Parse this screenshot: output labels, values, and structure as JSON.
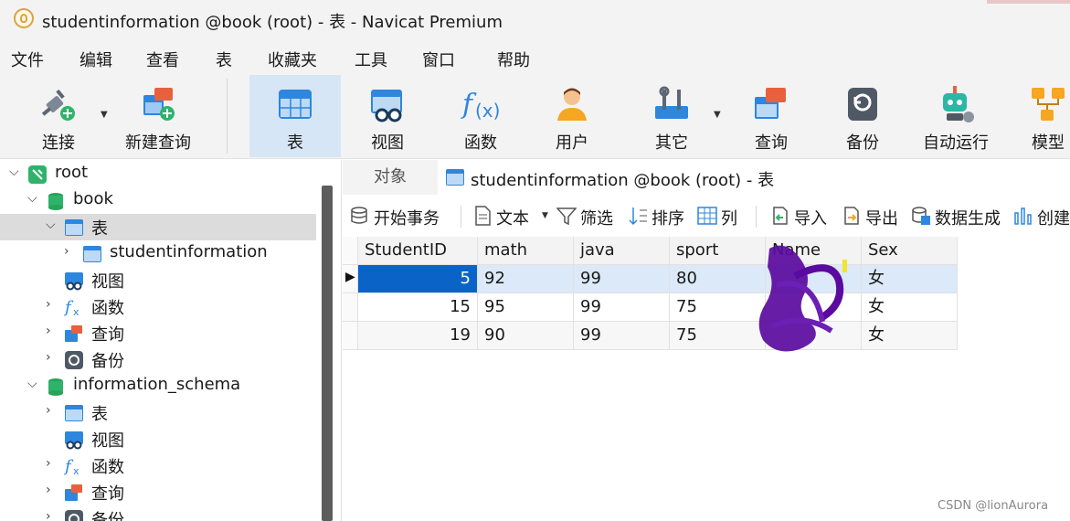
{
  "window": {
    "title": "studentinformation @book (root) - 表 - Navicat Premium"
  },
  "menu": [
    "文件",
    "编辑",
    "查看",
    "表",
    "收藏夹",
    "工具",
    "窗口",
    "帮助"
  ],
  "toolbar": {
    "connect": "连接",
    "new_query": "新建查询",
    "table": "表",
    "view": "视图",
    "function": "函数",
    "user": "用户",
    "other": "其它",
    "query": "查询",
    "backup": "备份",
    "automation": "自动运行",
    "model": "模型"
  },
  "sidebar": {
    "root": "root",
    "book": "book",
    "book_tables": "表",
    "book_table_item": "studentinformation",
    "book_views": "视图",
    "book_functions": "函数",
    "book_queries": "查询",
    "book_backups": "备份",
    "schema": "information_schema",
    "schema_tables": "表",
    "schema_views": "视图",
    "schema_functions": "函数",
    "schema_queries": "查询",
    "schema_backups": "备份"
  },
  "tabs": {
    "objects": "对象",
    "table": "studentinformation @book (root) - 表"
  },
  "table_toolbar": {
    "begin_transaction": "开始事务",
    "text": "文本",
    "filter": "筛选",
    "sort": "排序",
    "columns": "列",
    "import": "导入",
    "export": "导出",
    "data_generation": "数据生成",
    "create": "创建"
  },
  "grid": {
    "columns": [
      "StudentID",
      "math",
      "java",
      "sport",
      "Name",
      "Sex"
    ],
    "rows": [
      [
        "5",
        "92",
        "99",
        "80",
        "",
        "女"
      ],
      [
        "15",
        "95",
        "99",
        "75",
        "",
        "女"
      ],
      [
        "19",
        "90",
        "99",
        "75",
        "",
        "女"
      ]
    ]
  },
  "watermark": "CSDN @lionAurora",
  "colors": {
    "selection": "#dbe9f8",
    "focus_cell": "#0a64c8",
    "active_toolbar": "#d7e6f6",
    "scribble": "#5a0a9e"
  }
}
